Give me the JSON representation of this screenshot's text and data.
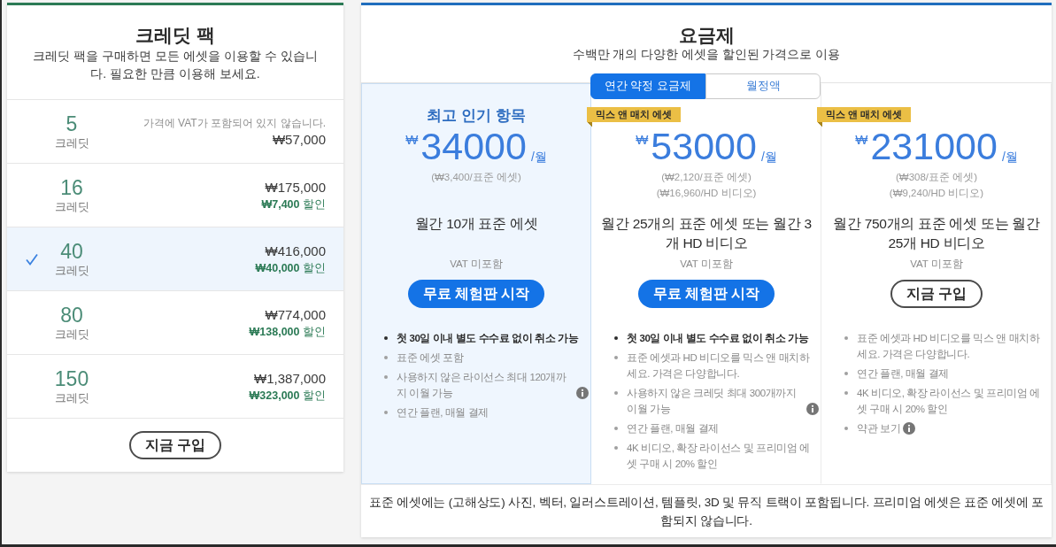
{
  "credit_packs": {
    "title": "크레딧 팩",
    "subtitle": "크레딧 팩을 구매하면 모든 에셋을 이용할 수 있습니다. 필요한 만큼 이용해 보세요.",
    "packs": [
      {
        "credits": "5",
        "unit": "크레딧",
        "note": "가격에 VAT가 포함되어 있지 않습니다.",
        "price": "₩57,000",
        "selected": false
      },
      {
        "credits": "16",
        "unit": "크레딧",
        "price": "₩175,000",
        "discount": "**₩7,400** 할인",
        "selected": false
      },
      {
        "credits": "40",
        "unit": "크레딧",
        "price": "₩416,000",
        "discount": "**₩40,000** 할인",
        "selected": true
      },
      {
        "credits": "80",
        "unit": "크레딧",
        "price": "₩774,000",
        "discount": "**₩138,000** 할인",
        "selected": false
      },
      {
        "credits": "150",
        "unit": "크레딧",
        "price": "₩1,387,000",
        "discount": "**₩323,000** 할인",
        "selected": false
      }
    ],
    "buy_button": "지금 구입"
  },
  "subscription": {
    "title": "요금제",
    "subtitle": "수백만 개의 다양한 에셋을 할인된 가격으로 이용",
    "billing_tabs": [
      {
        "label": "연간 약정 요금제",
        "selected": true
      },
      {
        "label": "월정액",
        "selected": false
      }
    ],
    "plans": [
      {
        "highlighted": true,
        "headline": "최고 인기 항목",
        "currency": "₩",
        "price": "34000",
        "period": "/월",
        "unit_prices": [
          "(₩3,400/표준 에셋)"
        ],
        "description": "월간 10개 표준 에셋",
        "vat_note": "VAT 미포함",
        "button": {
          "label": "무료 체험판 시작",
          "kind": "primary"
        },
        "features": [
          {
            "text": "첫 30일 이내 별도 수수료 없이 취소 가능",
            "emphasis": true,
            "info": false
          },
          {
            "text": "표준 에셋 포함",
            "emphasis": false,
            "info": false
          },
          {
            "text": "사용하지 않은 라이선스 최대 120개까지 이월 가능",
            "emphasis": false,
            "info": true
          },
          {
            "text": "연간 플랜, 매월 결제",
            "emphasis": false,
            "info": false
          }
        ]
      },
      {
        "highlighted": false,
        "ribbon": "믹스 앤 매치 에셋",
        "currency": "₩",
        "price": "53000",
        "period": "/월",
        "unit_prices": [
          "(₩2,120/표준 에셋)",
          "(₩16,960/HD 비디오)"
        ],
        "description": "월간 25개의 표준 에셋 또는 월간 3개 HD 비디오",
        "vat_note": "VAT 미포함",
        "button": {
          "label": "무료 체험판 시작",
          "kind": "primary"
        },
        "features": [
          {
            "text": "첫 30일 이내 별도 수수료 없이 취소 가능",
            "emphasis": true,
            "info": false
          },
          {
            "text": "표준 에셋과 HD 비디오를 믹스 앤 매치하세요. 가격은 다양합니다.",
            "emphasis": false,
            "info": false
          },
          {
            "text": "사용하지 않은 크레딧 최대 300개까지 이월 가능",
            "emphasis": false,
            "info": true
          },
          {
            "text": "연간 플랜, 매월 결제",
            "emphasis": false,
            "info": false
          },
          {
            "text": "4K 비디오, 확장 라이선스 및 프리미엄 에셋 구매 시 20% 할인",
            "emphasis": false,
            "info": false
          }
        ]
      },
      {
        "highlighted": false,
        "ribbon": "믹스 앤 매치 에셋",
        "currency": "₩",
        "price": "231000",
        "period": "/월",
        "unit_prices": [
          "(₩308/표준 에셋)",
          "(₩9,240/HD 비디오)"
        ],
        "description": "월간 750개의 표준 에셋 또는 월간 25개 HD 비디오",
        "vat_note": "VAT 미포함",
        "button": {
          "label": "지금 구입",
          "kind": "outline"
        },
        "features": [
          {
            "text": "표준 에셋과 HD 비디오를 믹스 앤 매치하세요. 가격은 다양합니다.",
            "emphasis": false,
            "info": false
          },
          {
            "text": "연간 플랜, 매월 결제",
            "emphasis": false,
            "info": false
          },
          {
            "text": "4K 비디오, 확장 라이선스 및 프리미엄 에셋 구매 시 20% 할인",
            "emphasis": false,
            "info": false
          },
          {
            "text": "약관 보기",
            "emphasis": false,
            "info": true
          }
        ]
      }
    ],
    "footnote": "표준 에셋에는 (고해상도) 사진, 벡터, 일러스트레이션, 템플릿, 3D 및 뮤직 트랙이 포함됩니다. 프리미엄 에셋은 표준 에셋에 포함되지 않습니다."
  }
}
